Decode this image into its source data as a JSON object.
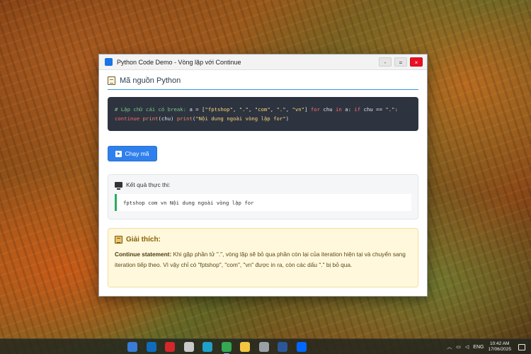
{
  "window": {
    "title": "Python Code Demo - Vòng lặp với Continue",
    "minimize_label": "-",
    "maximize_label": "=",
    "close_label": "×"
  },
  "code_section": {
    "title": "Mã nguồn Python",
    "code_tokens": [
      {
        "t": "# Lặp chữ cái có break: ",
        "c": "comment"
      },
      {
        "t": "a",
        "c": "plain"
      },
      {
        "t": " = [",
        "c": "plain"
      },
      {
        "t": "\"fptshop\"",
        "c": "string"
      },
      {
        "t": ", ",
        "c": "plain"
      },
      {
        "t": "\".\"",
        "c": "string"
      },
      {
        "t": ", ",
        "c": "plain"
      },
      {
        "t": "\"com\"",
        "c": "string"
      },
      {
        "t": ", ",
        "c": "plain"
      },
      {
        "t": "\".\"",
        "c": "string"
      },
      {
        "t": ", ",
        "c": "plain"
      },
      {
        "t": "\"vn\"",
        "c": "string"
      },
      {
        "t": "] ",
        "c": "plain"
      },
      {
        "t": "for",
        "c": "kw"
      },
      {
        "t": " chu ",
        "c": "plain"
      },
      {
        "t": "in",
        "c": "kw"
      },
      {
        "t": " a: ",
        "c": "plain"
      },
      {
        "t": "if",
        "c": "kw"
      },
      {
        "t": " chu ",
        "c": "plain"
      },
      {
        "t": "==",
        "c": "plain"
      },
      {
        "t": " ",
        "c": "plain"
      },
      {
        "t": "\".\"",
        "c": "string"
      },
      {
        "t": ": ",
        "c": "plain"
      },
      {
        "t": "continue",
        "c": "kw"
      },
      {
        "t": " ",
        "c": "plain"
      },
      {
        "t": "print",
        "c": "fn"
      },
      {
        "t": "(chu) ",
        "c": "plain"
      },
      {
        "t": "print",
        "c": "fn"
      },
      {
        "t": "(",
        "c": "plain"
      },
      {
        "t": "\"Nội dung ngoài vòng lặp for\"",
        "c": "string"
      },
      {
        "t": ")",
        "c": "plain"
      }
    ]
  },
  "run_button": {
    "label": "Chạy mã"
  },
  "output": {
    "title": "Kết quả thực thi:",
    "result": "fptshop com vn Nội dung ngoài vòng lặp for"
  },
  "explanation": {
    "title": "Giải thích:",
    "term": "Continue statement:",
    "text": " Khi gặp phần tử \".\", vòng lặp sẽ bỏ qua phần còn lại của iteration hiện tại và chuyển sang iteration tiếp theo. Vì vậy chỉ có \"fptshop\", \"com\", \"vn\" được in ra, còn các dấu \".\" bị bỏ qua."
  },
  "taskbar": {
    "apps": [
      {
        "name": "calculator-icon",
        "color": "#3a7bd5"
      },
      {
        "name": "outlook-icon",
        "color": "#0f6cbd"
      },
      {
        "name": "acrobat-icon",
        "color": "#d4262b"
      },
      {
        "name": "settings-sliders-icon",
        "color": "#c9c9c9"
      },
      {
        "name": "edge-icon",
        "color": "#1fa0c8"
      },
      {
        "name": "chrome-icon",
        "color": "#34a853"
      },
      {
        "name": "file-explorer-icon",
        "color": "#f4c542"
      },
      {
        "name": "app-icon",
        "color": "#9aa0a6"
      },
      {
        "name": "word-icon",
        "color": "#2b5797"
      },
      {
        "name": "zalo-icon",
        "color": "#0068ff"
      }
    ],
    "language": "ENG",
    "time": "10:42 AM",
    "date": "17/06/2025"
  },
  "colors": {
    "accent_blue": "#2f80ed",
    "code_bg": "#2d3440",
    "success_green": "#27ae60",
    "explain_bg": "#fff8dc"
  }
}
